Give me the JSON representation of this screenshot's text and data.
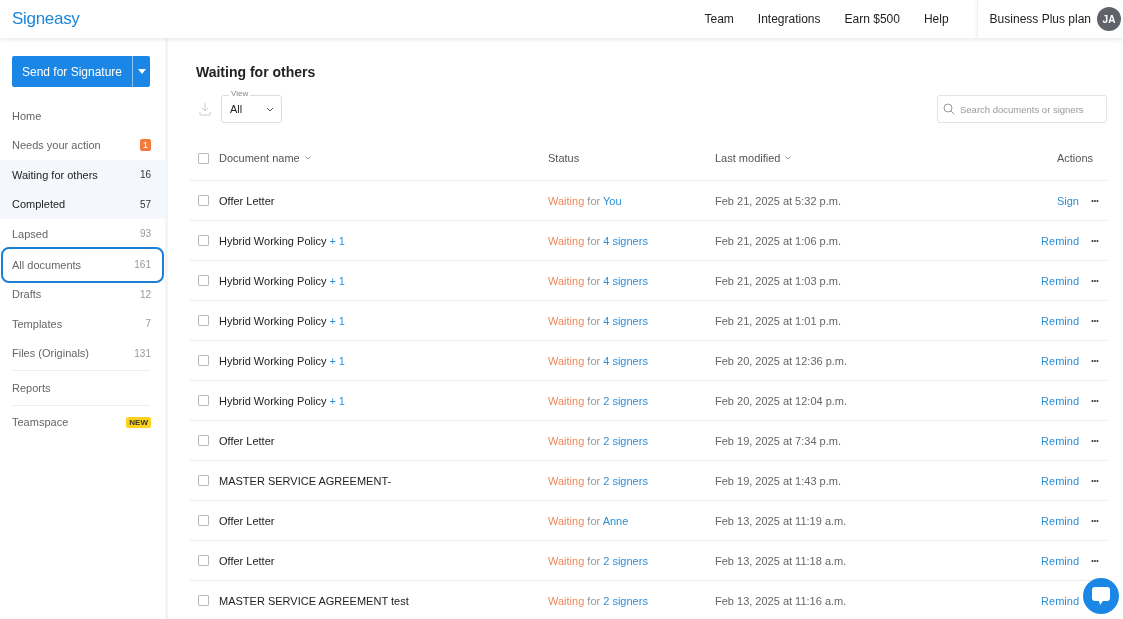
{
  "header": {
    "logo": "Signeasy",
    "nav": [
      "Team",
      "Integrations",
      "Earn $500",
      "Help"
    ],
    "plan": "Business Plus plan",
    "avatar": "JA"
  },
  "sidebar": {
    "send_button": "Send for Signature",
    "items": [
      {
        "label": "Home",
        "selected": false,
        "hovered": false,
        "outlined": false
      },
      {
        "label": "Needs your action",
        "badge": "1",
        "kind": "alert",
        "selected": false,
        "hovered": false,
        "outlined": false
      },
      {
        "label": "Waiting for others",
        "count": "16",
        "selected": true,
        "hovered": false,
        "outlined": false
      },
      {
        "label": "Completed",
        "count": "57",
        "selected": true,
        "hovered": false,
        "outlined": false
      },
      {
        "label": "Lapsed",
        "count": "93",
        "selected": false,
        "hovered": false,
        "outlined": false
      },
      {
        "label": "All documents",
        "count": "161",
        "selected": false,
        "hovered": false,
        "outlined": true
      },
      {
        "label": "Drafts",
        "count": "12",
        "selected": false,
        "hovered": false,
        "outlined": false
      },
      {
        "label": "Templates",
        "count": "7",
        "selected": false,
        "hovered": false,
        "outlined": false
      },
      {
        "label": "Files (Originals)",
        "count": "131",
        "selected": false,
        "hovered": false,
        "outlined": false,
        "divider_after": true
      },
      {
        "label": "Reports",
        "selected": false,
        "hovered": false,
        "outlined": false,
        "divider_after": true
      },
      {
        "label": "Teamspace",
        "badge": "NEW",
        "kind": "new",
        "selected": false,
        "hovered": false,
        "outlined": false
      }
    ]
  },
  "main": {
    "title": "Waiting for others",
    "view": {
      "label": "View",
      "value": "All"
    },
    "search": {
      "placeholder": "Search documents or signers"
    },
    "table": {
      "all_checked": false,
      "columns": [
        "Document name",
        "Status",
        "Last modified",
        "Actions"
      ],
      "rows": [
        {
          "name": "Offer Letter",
          "checked": false,
          "status": "Waiting",
          "for": "for",
          "target": "You",
          "modified": "Feb 21, 2025 at 5:32 p.m.",
          "action": "Sign",
          "menu": "•••"
        },
        {
          "name": "Hybrid Working Policy",
          "checked": false,
          "extra": "+ 1",
          "status": "Waiting",
          "for": "for",
          "target": "4 signers",
          "modified": "Feb 21, 2025 at 1:06 p.m.",
          "action": "Remind",
          "menu": "•••"
        },
        {
          "name": "Hybrid Working Policy",
          "checked": false,
          "extra": "+ 1",
          "status": "Waiting",
          "for": "for",
          "target": "4 signers",
          "modified": "Feb 21, 2025 at 1:03 p.m.",
          "action": "Remind",
          "menu": "•••"
        },
        {
          "name": "Hybrid Working Policy",
          "checked": false,
          "extra": "+ 1",
          "status": "Waiting",
          "for": "for",
          "target": "4 signers",
          "modified": "Feb 21, 2025 at 1:01 p.m.",
          "action": "Remind",
          "menu": "•••"
        },
        {
          "name": "Hybrid Working Policy",
          "checked": false,
          "extra": "+ 1",
          "status": "Waiting",
          "for": "for",
          "target": "4 signers",
          "modified": "Feb 20, 2025 at 12:36 p.m.",
          "action": "Remind",
          "menu": "•••"
        },
        {
          "name": "Hybrid Working Policy",
          "checked": false,
          "extra": "+ 1",
          "status": "Waiting",
          "for": "for",
          "target": "2 signers",
          "modified": "Feb 20, 2025 at 12:04 p.m.",
          "action": "Remind",
          "menu": "•••"
        },
        {
          "name": "Offer Letter",
          "checked": false,
          "status": "Waiting",
          "for": "for",
          "target": "2 signers",
          "modified": "Feb 19, 2025 at 7:34 p.m.",
          "action": "Remind",
          "menu": "•••"
        },
        {
          "name": "MASTER SERVICE AGREEMENT-",
          "checked": false,
          "status": "Waiting",
          "for": "for",
          "target": "2 signers",
          "modified": "Feb 19, 2025 at 1:43 p.m.",
          "action": "Remind",
          "menu": "•••"
        },
        {
          "name": "Offer Letter",
          "checked": false,
          "status": "Waiting",
          "for": "for",
          "target": "Anne",
          "modified": "Feb 13, 2025 at 11:19 a.m.",
          "action": "Remind",
          "menu": "•••"
        },
        {
          "name": "Offer Letter",
          "checked": false,
          "status": "Waiting",
          "for": "for",
          "target": "2 signers",
          "modified": "Feb 13, 2025 at 11:18 a.m.",
          "action": "Remind",
          "menu": "•••"
        },
        {
          "name": "MASTER SERVICE AGREEMENT test",
          "checked": false,
          "status": "Waiting",
          "for": "for",
          "target": "2 signers",
          "modified": "Feb 13, 2025 at 11:16 a.m.",
          "action": "Remind"
        }
      ]
    }
  }
}
